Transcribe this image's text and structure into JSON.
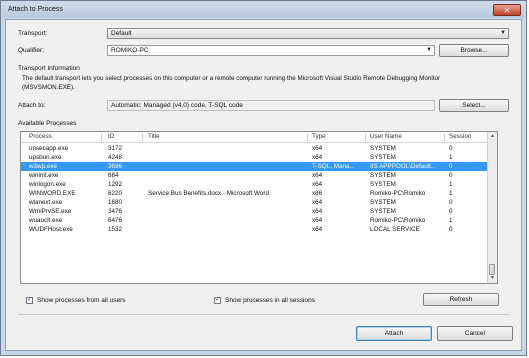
{
  "window": {
    "title": "Attach to Process",
    "close_glyph": "✕"
  },
  "transport": {
    "label": "Transport:",
    "value": "Default"
  },
  "qualifier": {
    "label": "Qualifier:",
    "value": "ROMIKO-PC",
    "browse_label": "Browse..."
  },
  "transport_info": {
    "heading": "Transport Information",
    "text": "The default transport lets you select processes on this computer or a remote computer running the Microsoft Visual Studio Remote Debugging Monitor (MSVSMON.EXE)."
  },
  "attach_to": {
    "label": "Attach to:",
    "value": "Automatic: Managed (v4.0) code, T-SQL code",
    "select_label": "Select..."
  },
  "available": {
    "heading": "Available Processes",
    "columns": [
      "Process",
      "ID",
      "Title",
      "Type",
      "User Name",
      "Session"
    ],
    "rows": [
      {
        "process": "unsecapp.exe",
        "id": "3172",
        "title": "",
        "type": "x64",
        "user": "SYSTEM",
        "session": "0",
        "selected": false
      },
      {
        "process": "upsbun.exe",
        "id": "4248",
        "title": "",
        "type": "x64",
        "user": "SYSTEM",
        "session": "1",
        "selected": false
      },
      {
        "process": "w3wp.exe",
        "id": "3696",
        "title": "",
        "type": "T-SQL, Mana...",
        "user": "IIS APPPOOL\\Default...",
        "session": "0",
        "selected": true
      },
      {
        "process": "wininit.exe",
        "id": "684",
        "title": "",
        "type": "x64",
        "user": "SYSTEM",
        "session": "0",
        "selected": false
      },
      {
        "process": "winlogon.exe",
        "id": "1292",
        "title": "",
        "type": "x64",
        "user": "SYSTEM",
        "session": "1",
        "selected": false
      },
      {
        "process": "WINWORD.EXE",
        "id": "6220",
        "title": "Service Bus Benefits.docx - Microsoft Word",
        "type": "x86",
        "user": "Romiko-PC\\Romiko",
        "session": "1",
        "selected": false
      },
      {
        "process": "wlanext.exe",
        "id": "1680",
        "title": "",
        "type": "x64",
        "user": "SYSTEM",
        "session": "0",
        "selected": false
      },
      {
        "process": "WmiPrvSE.exe",
        "id": "3476",
        "title": "",
        "type": "x64",
        "user": "SYSTEM",
        "session": "0",
        "selected": false
      },
      {
        "process": "wuauclt.exe",
        "id": "6476",
        "title": "",
        "type": "x64",
        "user": "Romiko-PC\\Romiko",
        "session": "1",
        "selected": false
      },
      {
        "process": "WUDFHost.exe",
        "id": "1532",
        "title": "",
        "type": "x64",
        "user": "LOCAL SERVICE",
        "session": "0",
        "selected": false
      }
    ]
  },
  "options": {
    "all_users": {
      "label": "Show processes from all users",
      "checked": true
    },
    "all_sessions": {
      "label": "Show processes in all sessions",
      "checked": true
    }
  },
  "buttons": {
    "refresh": "Refresh",
    "attach": "Attach",
    "cancel": "Cancel"
  },
  "glyphs": {
    "check": "✓",
    "dropdown": "▼",
    "scroll_up": "▲",
    "scroll_down": "▼"
  },
  "colors": {
    "selection": "#3399ff",
    "title_bar": "#c9d7e7",
    "close": "#c4442f"
  }
}
